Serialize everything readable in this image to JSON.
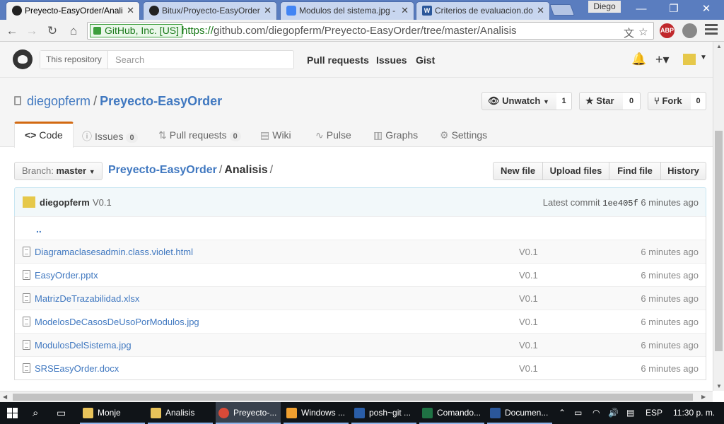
{
  "browser": {
    "tabs": [
      {
        "title": "Preyecto-EasyOrder/Anali",
        "icon": "github-icon",
        "active": true
      },
      {
        "title": "Bitux/Proyecto-EasyOrder",
        "icon": "github-icon",
        "active": false
      },
      {
        "title": "Modulos del sistema.jpg -",
        "icon": "google-drive-icon",
        "active": false
      },
      {
        "title": "Criterios de evaluacion.do",
        "icon": "word-icon",
        "active": false
      }
    ],
    "user_badge": "Diego",
    "secure_label": "GitHub, Inc. [US]",
    "url_scheme": "https://",
    "url_rest": "github.com/diegopferm/Preyecto-EasyOrder/tree/master/Analisis",
    "abp_label": "ABP"
  },
  "github_header": {
    "search_scope": "This repository",
    "search_placeholder": "Search",
    "nav": [
      "Pull requests",
      "Issues",
      "Gist"
    ]
  },
  "repo": {
    "owner": "diegopferm",
    "name": "Preyecto-EasyOrder",
    "watch_label": "Unwatch",
    "watch_count": "1",
    "star_label": "Star",
    "star_count": "0",
    "fork_label": "Fork",
    "fork_count": "0",
    "tabs": [
      {
        "label": "Code",
        "icon": "code-icon",
        "counter": null,
        "selected": true
      },
      {
        "label": "Issues",
        "icon": "issue-icon",
        "counter": "0",
        "selected": false
      },
      {
        "label": "Pull requests",
        "icon": "pull-request-icon",
        "counter": "0",
        "selected": false
      },
      {
        "label": "Wiki",
        "icon": "book-icon",
        "counter": null,
        "selected": false
      },
      {
        "label": "Pulse",
        "icon": "pulse-icon",
        "counter": null,
        "selected": false
      },
      {
        "label": "Graphs",
        "icon": "graph-icon",
        "counter": null,
        "selected": false
      },
      {
        "label": "Settings",
        "icon": "gear-icon",
        "counter": null,
        "selected": false
      }
    ]
  },
  "file_nav": {
    "branch_prefix": "Branch:",
    "branch": "master",
    "breadcrumb_root": "Preyecto-EasyOrder",
    "breadcrumb_current": "Analisis",
    "breadcrumb_sep": "/",
    "buttons": [
      "New file",
      "Upload files",
      "Find file",
      "History"
    ]
  },
  "latest_commit": {
    "author": "diegopferm",
    "message": "V0.1",
    "label": "Latest commit",
    "sha": "1ee405f",
    "age": "6 minutes ago"
  },
  "files": {
    "up_link": "..",
    "rows": [
      {
        "name": "Diagramaclasesadmin.class.violet.html",
        "message": "V0.1",
        "age": "6 minutes ago"
      },
      {
        "name": "EasyOrder.pptx",
        "message": "V0.1",
        "age": "6 minutes ago"
      },
      {
        "name": "MatrizDeTrazabilidad.xlsx",
        "message": "V0.1",
        "age": "6 minutes ago"
      },
      {
        "name": "ModelosDeCasosDeUsoPorModulos.jpg",
        "message": "V0.1",
        "age": "6 minutes ago"
      },
      {
        "name": "ModulosDelSistema.jpg",
        "message": "V0.1",
        "age": "6 minutes ago"
      },
      {
        "name": "SRSEasyOrder.docx",
        "message": "V0.1",
        "age": "6 minutes ago"
      }
    ]
  },
  "taskbar": {
    "items": [
      {
        "label": "Monje",
        "icon": "folder-icon",
        "color": "#e8c35a",
        "active": false
      },
      {
        "label": "Analisis",
        "icon": "folder-icon",
        "color": "#e8c35a",
        "active": false
      },
      {
        "label": "Preyecto-...",
        "icon": "chrome-icon",
        "color": "#d94a38",
        "active": true
      },
      {
        "label": "Windows ...",
        "icon": "media-player-icon",
        "color": "#f0a030",
        "active": false
      },
      {
        "label": "posh~git ...",
        "icon": "powershell-icon",
        "color": "#2a5ea8",
        "active": false
      },
      {
        "label": "Comando...",
        "icon": "excel-icon",
        "color": "#1f7244",
        "active": false
      },
      {
        "label": "Documen...",
        "icon": "word-icon",
        "color": "#2b579a",
        "active": false
      }
    ],
    "language": "ESP",
    "clock": "11:30 p. m."
  },
  "colors": {
    "link": "#4078c0",
    "tab_accent": "#d26911",
    "chrome_frame": "#5a7dbf",
    "taskbar": "#101418"
  }
}
